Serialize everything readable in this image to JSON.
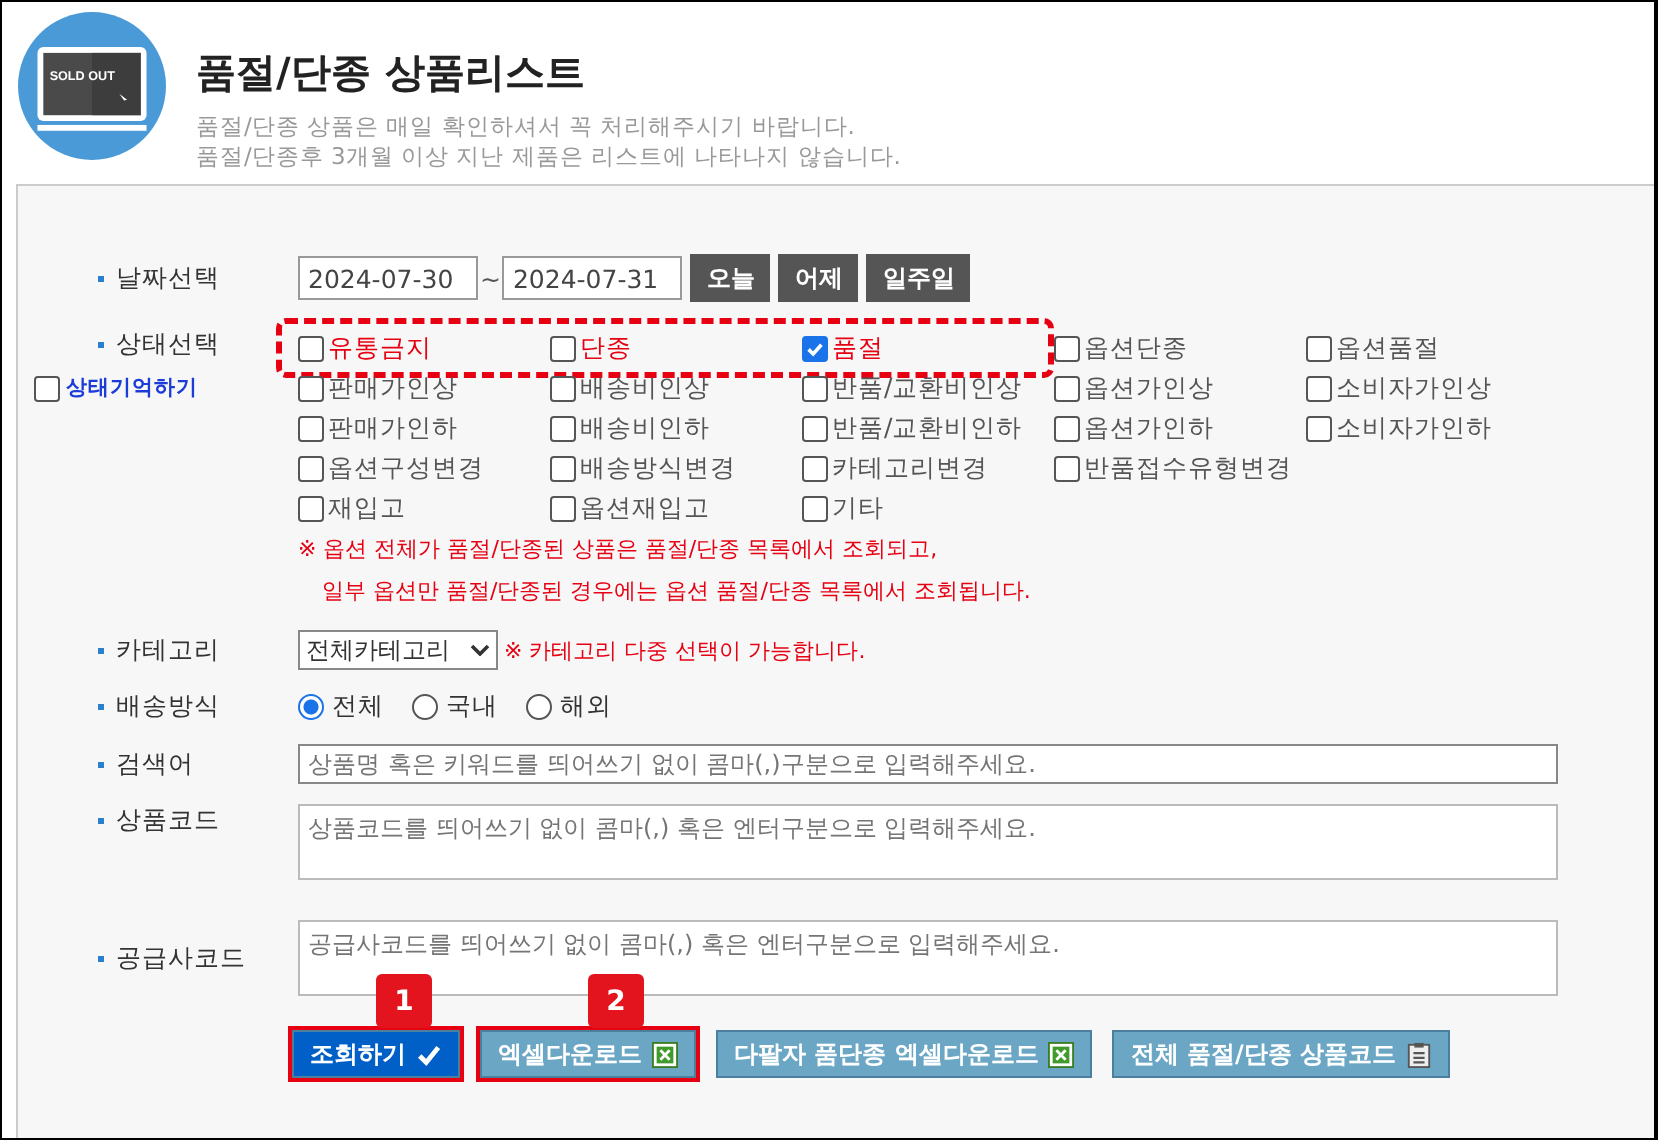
{
  "header": {
    "icon_label": "SOLD OUT",
    "title": "품절/단종 상품리스트",
    "notes": [
      "품절/단종 상품은 매일 확인하셔서 꼭 처리해주시기 바랍니다.",
      "품절/단종후 3개월 이상 지난 제품은 리스트에 나타나지 않습니다."
    ]
  },
  "date": {
    "label": "날짜선택",
    "from": "2024-07-30",
    "separator": "~",
    "to": "2024-07-31",
    "buttons": [
      "오늘",
      "어제",
      "일주일"
    ]
  },
  "status": {
    "label": "상태선택",
    "remember": {
      "label": "상태기억하기",
      "checked": false
    },
    "rows": [
      [
        {
          "label": "유통금지",
          "checked": false,
          "highlighted": true
        },
        {
          "label": "단종",
          "checked": false,
          "highlighted": true
        },
        {
          "label": "품절",
          "checked": true,
          "highlighted": true
        },
        {
          "label": "옵션단종",
          "checked": false,
          "highlighted": false
        },
        {
          "label": "옵션품절",
          "checked": false,
          "highlighted": false
        }
      ],
      [
        {
          "label": "판매가인상",
          "checked": false,
          "highlighted": false
        },
        {
          "label": "배송비인상",
          "checked": false,
          "highlighted": false
        },
        {
          "label": "반품/교환비인상",
          "checked": false,
          "highlighted": false
        },
        {
          "label": "옵션가인상",
          "checked": false,
          "highlighted": false
        },
        {
          "label": "소비자가인상",
          "checked": false,
          "highlighted": false
        }
      ],
      [
        {
          "label": "판매가인하",
          "checked": false,
          "highlighted": false
        },
        {
          "label": "배송비인하",
          "checked": false,
          "highlighted": false
        },
        {
          "label": "반품/교환비인하",
          "checked": false,
          "highlighted": false
        },
        {
          "label": "옵션가인하",
          "checked": false,
          "highlighted": false
        },
        {
          "label": "소비자가인하",
          "checked": false,
          "highlighted": false
        }
      ],
      [
        {
          "label": "옵션구성변경",
          "checked": false,
          "highlighted": false
        },
        {
          "label": "배송방식변경",
          "checked": false,
          "highlighted": false
        },
        {
          "label": "카테고리변경",
          "checked": false,
          "highlighted": false
        },
        {
          "label": "반품접수유형변경",
          "checked": false,
          "highlighted": false
        }
      ],
      [
        {
          "label": "재입고",
          "checked": false,
          "highlighted": false
        },
        {
          "label": "옵션재입고",
          "checked": false,
          "highlighted": false
        },
        {
          "label": "기타",
          "checked": false,
          "highlighted": false
        }
      ]
    ],
    "notes": [
      "※ 옵션 전체가 품절/단종된 상품은 품절/단종 목록에서 조회되고,",
      "일부 옵션만 품절/단종된 경우에는 옵션 품절/단종 목록에서 조회됩니다."
    ]
  },
  "category": {
    "label": "카테고리",
    "value": "전체카테고리",
    "note": "※ 카테고리 다중 선택이 가능합니다."
  },
  "shipping": {
    "label": "배송방식",
    "options": [
      {
        "label": "전체",
        "selected": true
      },
      {
        "label": "국내",
        "selected": false
      },
      {
        "label": "해외",
        "selected": false
      }
    ]
  },
  "search": {
    "label": "검색어",
    "placeholder": "상품명 혹은 키워드를 띄어쓰기 없이 콤마(,)구분으로 입력해주세요."
  },
  "product_code": {
    "label": "상품코드",
    "placeholder": "상품코드를 띄어쓰기 없이 콤마(,) 혹은 엔터구분으로 입력해주세요."
  },
  "supplier_code": {
    "label": "공급사코드",
    "placeholder": "공급사코드를 띄어쓰기 없이 콤마(,) 혹은 엔터구분으로 입력해주세요."
  },
  "actions": [
    {
      "label": "조회하기",
      "kind": "submit",
      "badge": "1",
      "highlighted": true
    },
    {
      "label": "엑셀다운로드",
      "kind": "excel",
      "badge": "2",
      "highlighted": true
    },
    {
      "label": "다팔자 품단종 엑셀다운로드",
      "kind": "excel",
      "highlighted": false
    },
    {
      "label": "전체 품절/단종 상품코드",
      "kind": "list",
      "highlighted": false
    }
  ]
}
